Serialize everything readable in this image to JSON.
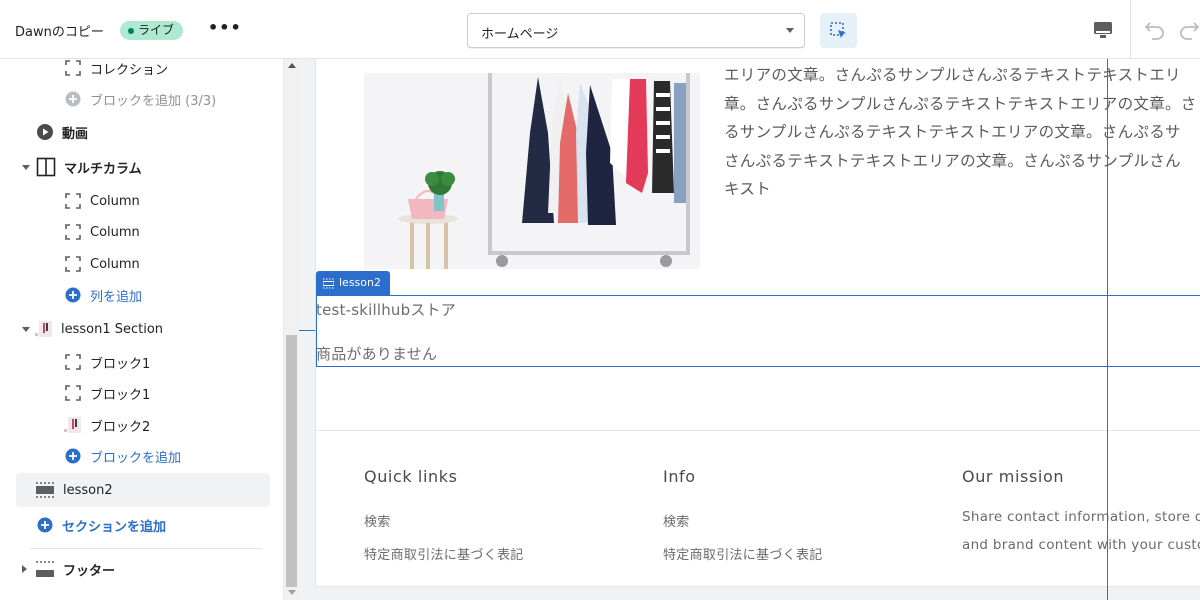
{
  "topbar": {
    "theme_name": "Dawnのコピー",
    "live_label": "ライブ",
    "more_label": "•••",
    "page_select_value": "ホームページ"
  },
  "sidebar": {
    "items": [
      {
        "label": "コレクション",
        "icon": "block-icon"
      },
      {
        "label": "ブロックを追加 (3/3)",
        "icon": "add-circle-icon"
      },
      {
        "label": "動画",
        "icon": "play-icon"
      },
      {
        "label": "マルチカラム",
        "icon": "columns-icon"
      },
      {
        "label": "Column",
        "icon": "block-icon"
      },
      {
        "label": "Column",
        "icon": "block-icon"
      },
      {
        "label": "Column",
        "icon": "block-icon"
      },
      {
        "label": "列を追加",
        "icon": "add-circle-icon"
      },
      {
        "label": "lesson1 Section",
        "icon": "image-thumb-icon"
      },
      {
        "label": "ブロック1",
        "icon": "block-icon"
      },
      {
        "label": "ブロック1",
        "icon": "block-icon"
      },
      {
        "label": "ブロック2",
        "icon": "image-thumb-icon"
      },
      {
        "label": "ブロックを追加",
        "icon": "add-circle-icon"
      },
      {
        "label": "lesson2",
        "icon": "section-icon"
      },
      {
        "label": "セクションを追加",
        "icon": "add-circle-icon"
      },
      {
        "label": "フッター",
        "icon": "footer-icon"
      }
    ]
  },
  "preview": {
    "body_lines": [
      "エリアの文章。さんぷるサンプルさんぷるテキストテキストエリ",
      "章。さんぷるサンプルさんぷるテキストテキストエリアの文章。さ",
      "るサンプルさんぷるテキストテキストエリアの文章。さんぷるサ",
      "さんぷるテキストテキストエリアの文章。さんぷるサンプルさん",
      "キスト"
    ],
    "section_tag": "lesson2",
    "store_name": "test-skillhubストア",
    "no_products": "商品がありません",
    "footer": {
      "col1": {
        "heading": "Quick links",
        "links": [
          "検索",
          "特定商取引法に基づく表記"
        ]
      },
      "col2": {
        "heading": "Info",
        "links": [
          "検索",
          "特定商取引法に基づく表記"
        ]
      },
      "col3": {
        "heading": "Our mission",
        "lines": [
          "Share contact information, store d",
          "and brand content with your custo"
        ]
      }
    }
  },
  "colors": {
    "accent": "#2c6ecb",
    "live_badge": "#aee9d1",
    "live_dot": "#007f5f"
  }
}
